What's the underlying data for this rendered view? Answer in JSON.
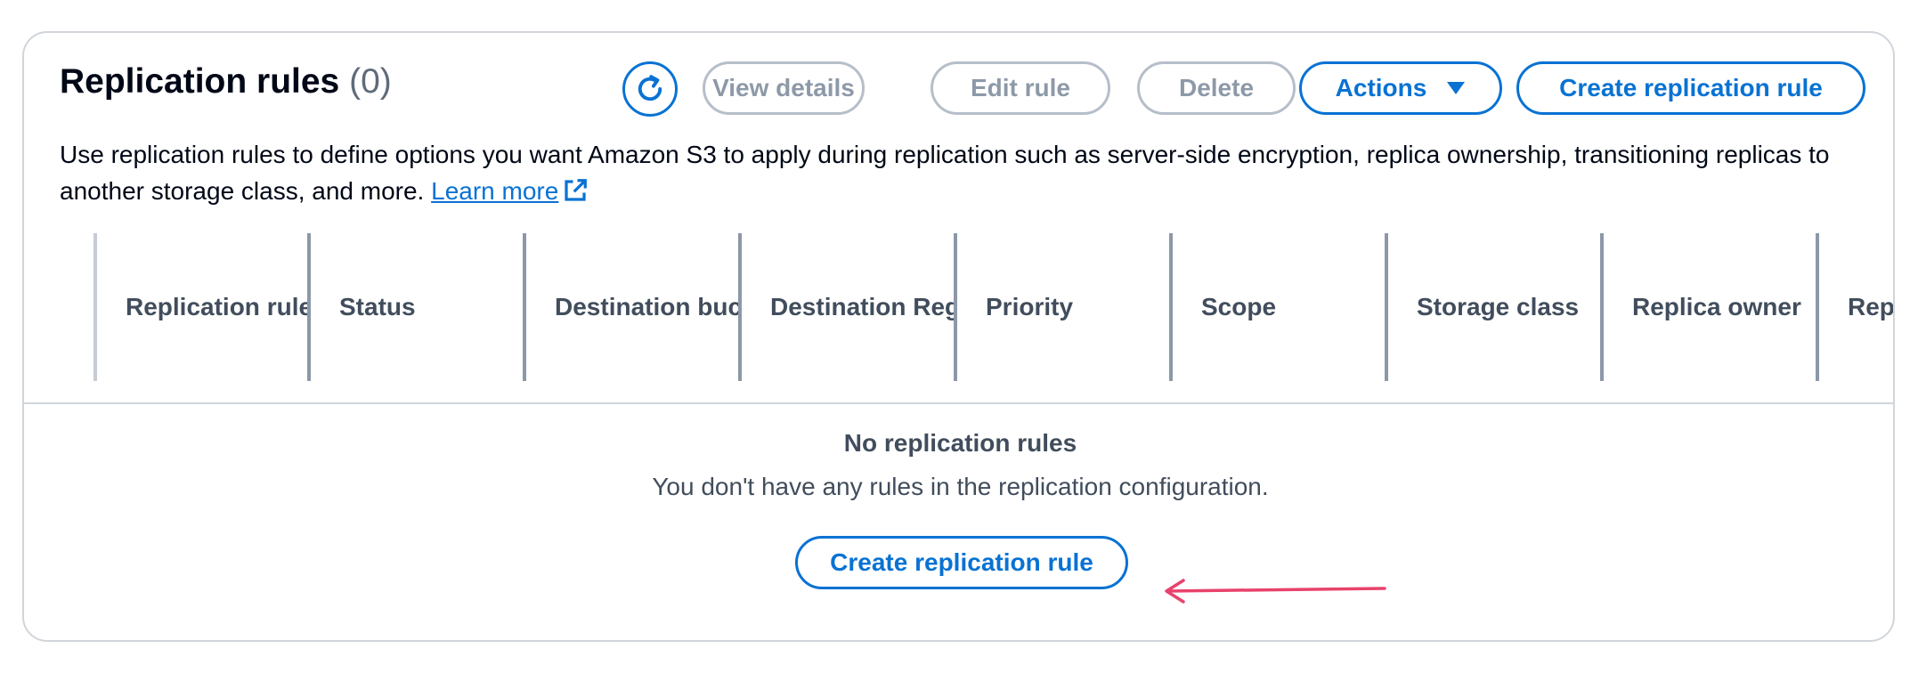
{
  "header": {
    "title": "Replication rules",
    "count": "(0)"
  },
  "toolbar": {
    "refresh_icon": "refresh-icon",
    "view_details": "View details",
    "edit_rule": "Edit rule",
    "delete": "Delete",
    "actions": "Actions",
    "create_rule": "Create replication rule"
  },
  "description": {
    "text": "Use replication rules to define options you want Amazon S3 to apply during replication such as server-side encryption, replica ownership, transitioning replicas to another storage class, and more.",
    "link": "Learn more",
    "link_icon": "external-link-icon"
  },
  "table": {
    "columns": [
      "Replication rule name",
      "Status",
      "Destination bucket",
      "Destination Region",
      "Priority",
      "Scope",
      "Storage class",
      "Replica owner",
      "Replication Time"
    ]
  },
  "empty_state": {
    "title": "No replication rules",
    "message": "You don't have any rules in the replication configuration.",
    "button": "Create replication rule"
  },
  "annotation": {
    "arrow_color": "#e8426b"
  },
  "colors": {
    "accent": "#0972d3",
    "disabled": "#8d99a8"
  }
}
